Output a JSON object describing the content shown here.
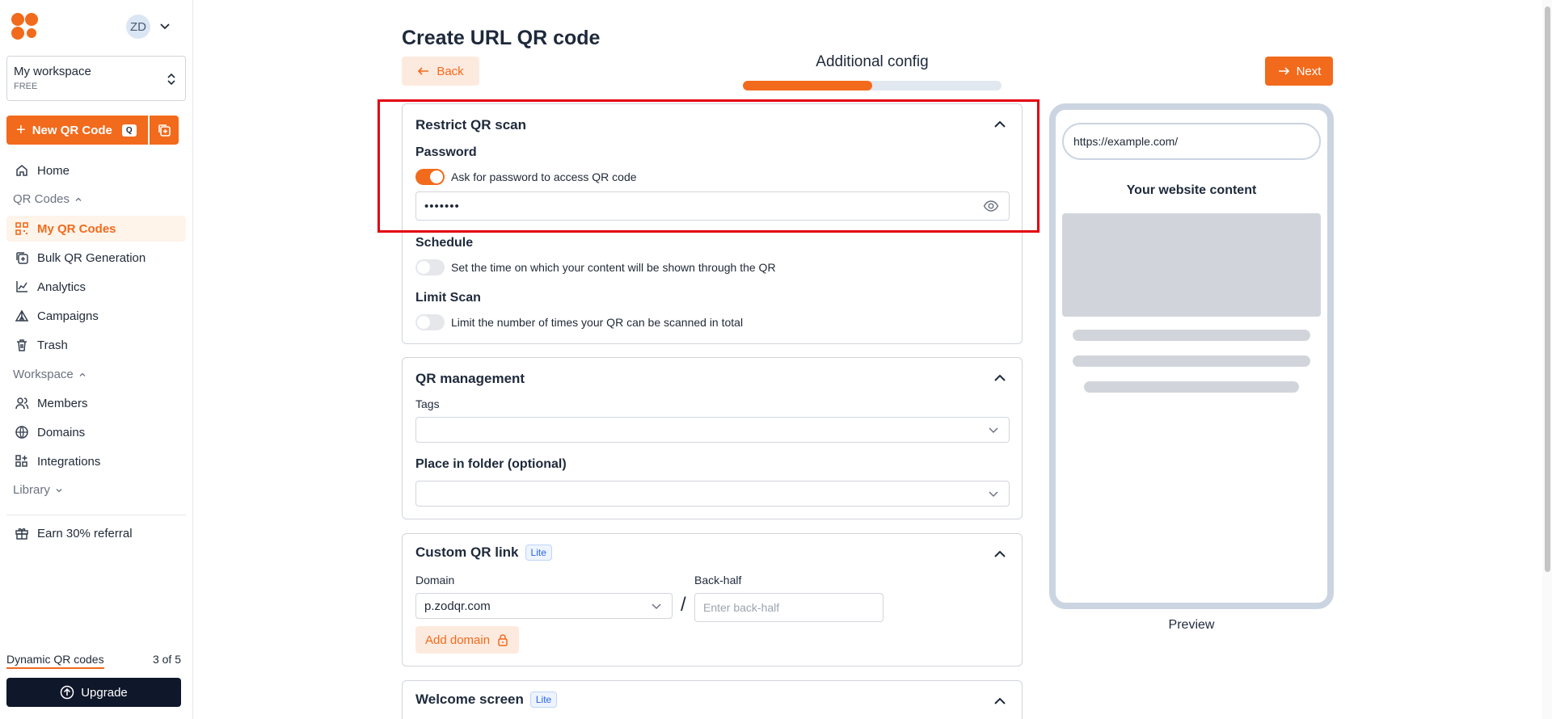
{
  "sidebar": {
    "avatar_initials": "ZD",
    "workspace": {
      "name": "My workspace",
      "plan": "FREE"
    },
    "new_qr": {
      "label": "New QR Code",
      "shortcut": "Q"
    },
    "nav": {
      "home": "Home",
      "qr_codes_section": "QR Codes",
      "my_qr_codes": "My QR Codes",
      "bulk": "Bulk QR Generation",
      "analytics": "Analytics",
      "campaigns": "Campaigns",
      "trash": "Trash",
      "workspace_section": "Workspace",
      "members": "Members",
      "domains": "Domains",
      "integrations": "Integrations",
      "library_section": "Library",
      "referral": "Earn 30% referral"
    },
    "quota": {
      "label": "Dynamic QR codes",
      "value": "3 of 5",
      "used": 3,
      "total": 5
    },
    "upgrade_label": "Upgrade"
  },
  "header": {
    "title": "Create URL QR code",
    "back_label": "Back",
    "step_title": "Additional config",
    "step_progress": 0.5,
    "next_label": "Next"
  },
  "restrict": {
    "title": "Restrict QR scan",
    "password_label": "Password",
    "password_toggle_text": "Ask for password to access QR code",
    "password_enabled": true,
    "password_value": "•••••••",
    "schedule_label": "Schedule",
    "schedule_text": "Set the time on which your content will be shown through the QR",
    "schedule_enabled": false,
    "limit_label": "Limit Scan",
    "limit_text": "Limit the number of times your QR can be scanned in total",
    "limit_enabled": false
  },
  "management": {
    "title": "QR management",
    "tags_label": "Tags",
    "tags_value": "",
    "folder_label": "Place in folder (optional)",
    "folder_value": ""
  },
  "custom_link": {
    "title": "Custom QR link",
    "badge": "Lite",
    "domain_label": "Domain",
    "domain_value": "p.zodqr.com",
    "slash": "/",
    "backhalf_label": "Back-half",
    "backhalf_placeholder": "Enter back-half",
    "add_domain_label": "Add domain"
  },
  "welcome": {
    "title": "Welcome screen",
    "badge": "Lite"
  },
  "preview": {
    "url": "https://example.com/",
    "heading": "Your website content",
    "label": "Preview"
  },
  "colors": {
    "accent": "#f26a1b",
    "highlight": "#e3000f",
    "dark": "#0f172a"
  }
}
